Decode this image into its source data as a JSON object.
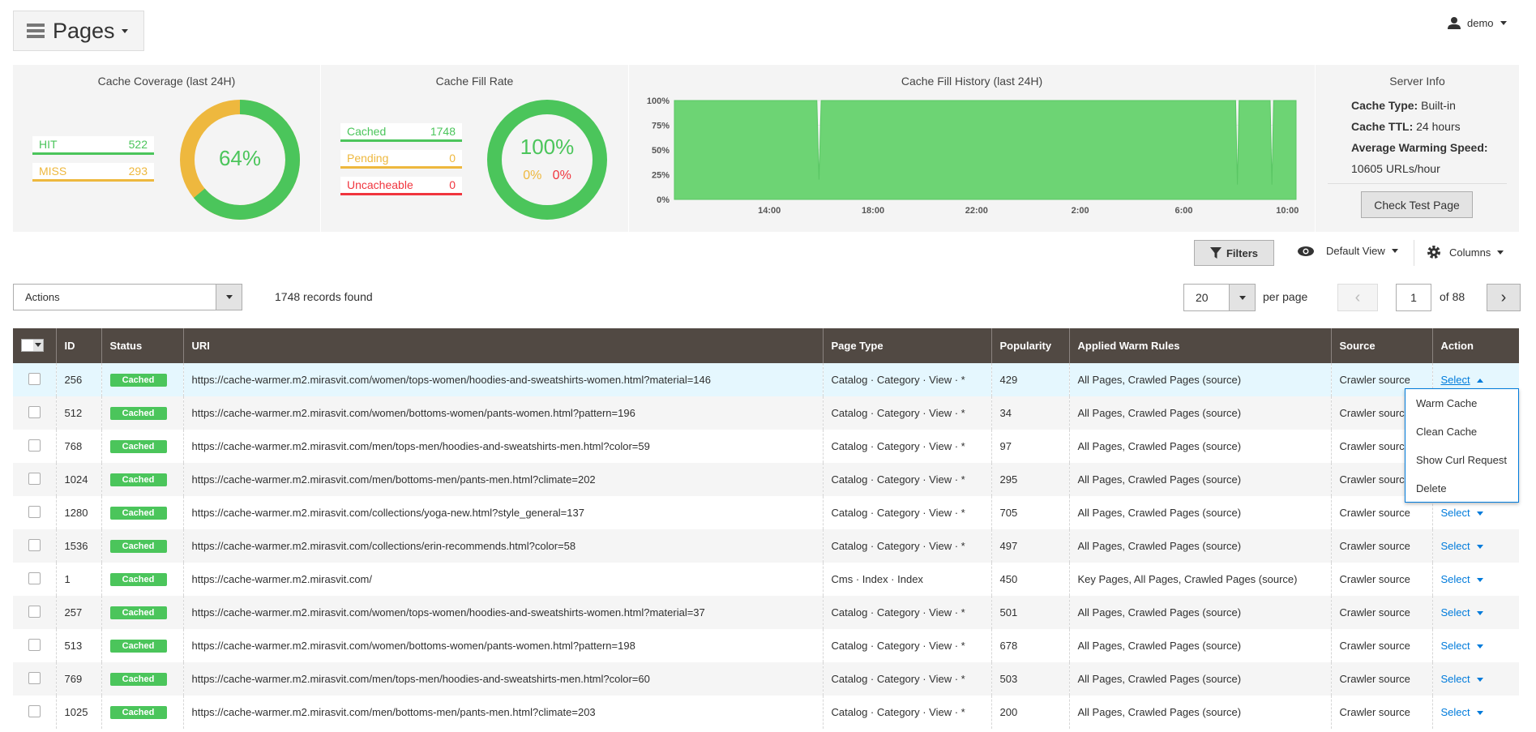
{
  "header": {
    "title": "Pages",
    "user": "demo"
  },
  "coverage": {
    "title": "Cache Coverage (last 24H)",
    "hit_label": "HIT",
    "hit": 522,
    "miss_label": "MISS",
    "miss": 293,
    "percent": "64%",
    "hit_fraction": 0.64
  },
  "fill_rate": {
    "title": "Cache Fill Rate",
    "cached_label": "Cached",
    "cached": 1748,
    "pending_label": "Pending",
    "pending": 0,
    "uncacheable_label": "Uncacheable",
    "uncacheable": 0,
    "percent": "100%",
    "pending_pct": "0%",
    "uncacheable_pct": "0%"
  },
  "colors": {
    "green": "#4bc55b",
    "orange": "#eeb83e",
    "red": "#f0353e",
    "header_bg": "#514943",
    "link": "#007bdb"
  },
  "chart_data": {
    "type": "area",
    "title": "Cache Fill History (last 24H)",
    "y_ticks": [
      "0%",
      "25%",
      "50%",
      "75%",
      "100%"
    ],
    "ylim": [
      0,
      100
    ],
    "x_ticks": [
      "14:00",
      "18:00",
      "22:00",
      "2:00",
      "6:00",
      "10:00"
    ],
    "x_range": [
      "10:20",
      "10:20"
    ],
    "points": [
      [
        "10:20",
        100
      ],
      [
        "15:50",
        100
      ],
      [
        "15:55",
        20
      ],
      [
        "16:00",
        100
      ],
      [
        "8:00",
        100
      ],
      [
        "8:04",
        15
      ],
      [
        "8:08",
        100
      ],
      [
        "9:20",
        100
      ],
      [
        "9:24",
        15
      ],
      [
        "9:28",
        100
      ],
      [
        "10:20",
        100
      ]
    ]
  },
  "server": {
    "title": "Server Info",
    "type_label": "Cache Type:",
    "type": "Built-in",
    "ttl_label": "Cache TTL:",
    "ttl": "24 hours",
    "speed_label": "Average Warming Speed:",
    "speed": "10605 URLs/hour",
    "check_button": "Check Test Page"
  },
  "toolbar": {
    "filters": "Filters",
    "view": "Default View",
    "columns": "Columns",
    "actions": "Actions",
    "records": "1748 records found",
    "per_page": "20",
    "per_page_label": "per page",
    "page": "1",
    "of_pages": "of 88"
  },
  "table": {
    "headers": [
      "ID",
      "Status",
      "URI",
      "Page Type",
      "Popularity",
      "Applied Warm Rules",
      "Source",
      "Action"
    ],
    "rows": [
      [
        "256",
        "Cached",
        "https://cache-warmer.m2.mirasvit.com/women/tops-women/hoodies-and-sweatshirts-women.html?material=146",
        "Catalog · Category · View · *",
        "429",
        "All Pages, Crawled Pages (source)",
        "Crawler source",
        "Select"
      ],
      [
        "512",
        "Cached",
        "https://cache-warmer.m2.mirasvit.com/women/bottoms-women/pants-women.html?pattern=196",
        "Catalog · Category · View · *",
        "34",
        "All Pages, Crawled Pages (source)",
        "Crawler source",
        "Select"
      ],
      [
        "768",
        "Cached",
        "https://cache-warmer.m2.mirasvit.com/men/tops-men/hoodies-and-sweatshirts-men.html?color=59",
        "Catalog · Category · View · *",
        "97",
        "All Pages, Crawled Pages (source)",
        "Crawler source",
        "Select"
      ],
      [
        "1024",
        "Cached",
        "https://cache-warmer.m2.mirasvit.com/men/bottoms-men/pants-men.html?climate=202",
        "Catalog · Category · View · *",
        "295",
        "All Pages, Crawled Pages (source)",
        "Crawler source",
        "Select"
      ],
      [
        "1280",
        "Cached",
        "https://cache-warmer.m2.mirasvit.com/collections/yoga-new.html?style_general=137",
        "Catalog · Category · View · *",
        "705",
        "All Pages, Crawled Pages (source)",
        "Crawler source",
        "Select"
      ],
      [
        "1536",
        "Cached",
        "https://cache-warmer.m2.mirasvit.com/collections/erin-recommends.html?color=58",
        "Catalog · Category · View · *",
        "497",
        "All Pages, Crawled Pages (source)",
        "Crawler source",
        "Select"
      ],
      [
        "1",
        "Cached",
        "https://cache-warmer.m2.mirasvit.com/",
        "Cms · Index · Index",
        "450",
        "Key Pages, All Pages, Crawled Pages (source)",
        "Crawler source",
        "Select"
      ],
      [
        "257",
        "Cached",
        "https://cache-warmer.m2.mirasvit.com/women/tops-women/hoodies-and-sweatshirts-women.html?material=37",
        "Catalog · Category · View · *",
        "501",
        "All Pages, Crawled Pages (source)",
        "Crawler source",
        "Select"
      ],
      [
        "513",
        "Cached",
        "https://cache-warmer.m2.mirasvit.com/women/bottoms-women/pants-women.html?pattern=198",
        "Catalog · Category · View · *",
        "678",
        "All Pages, Crawled Pages (source)",
        "Crawler source",
        "Select"
      ],
      [
        "769",
        "Cached",
        "https://cache-warmer.m2.mirasvit.com/men/tops-men/hoodies-and-sweatshirts-men.html?color=60",
        "Catalog · Category · View · *",
        "503",
        "All Pages, Crawled Pages (source)",
        "Crawler source",
        "Select"
      ],
      [
        "1025",
        "Cached",
        "https://cache-warmer.m2.mirasvit.com/men/bottoms-men/pants-men.html?climate=203",
        "Catalog · Category · View · *",
        "200",
        "All Pages, Crawled Pages (source)",
        "Crawler source",
        "Select"
      ]
    ]
  },
  "action_menu": [
    "Warm Cache",
    "Clean Cache",
    "Show Curl Request",
    "Delete"
  ]
}
